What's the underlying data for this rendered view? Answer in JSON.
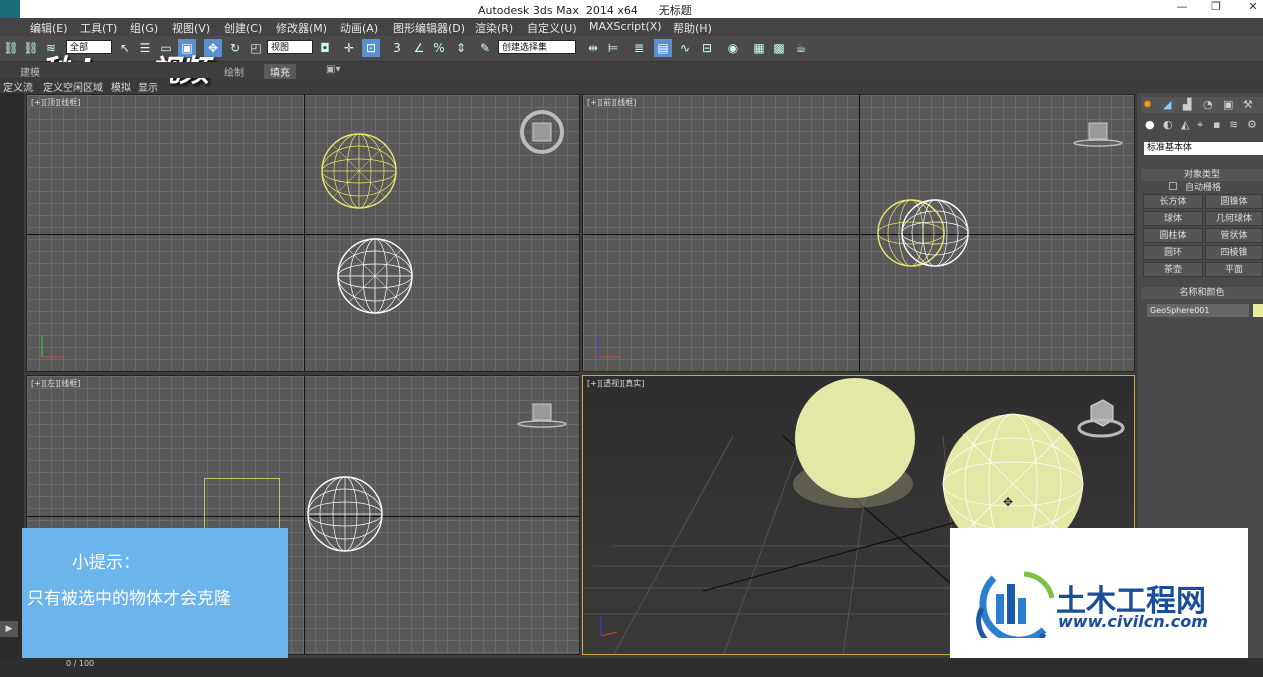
{
  "window": {
    "title": "Autodesk 3ds Max  2014 x64      无标题"
  },
  "menu": [
    "编辑(E)",
    "工具(T)",
    "组(G)",
    "视图(V)",
    "创建(C)",
    "修改器(M)",
    "动画(A)",
    "图形编辑器(D)",
    "渲染(R)",
    "自定义(U)",
    "MAXScript(X)",
    "帮助(H)"
  ],
  "toolbar": {
    "filter_value": "全部",
    "ref_coord": "视图",
    "selection_set": "创建选择集"
  },
  "ribbon": {
    "tabs": [
      "建模",
      "绘制",
      "填充"
    ]
  },
  "subtabs": [
    "定义流",
    "定义空闲区域",
    "模拟",
    "显示"
  ],
  "viewports": {
    "top": {
      "label": "[+][顶][线框]"
    },
    "front": {
      "label": "[+][前][线框]"
    },
    "left": {
      "label": "[+][左][线框]"
    },
    "perspective": {
      "label": "[+][透视][真实]"
    }
  },
  "command_panel": {
    "category": "标准基本体",
    "rollout_object_type": "对象类型",
    "autogrid": "自动栅格",
    "buttons": [
      "长方体",
      "圆锥体",
      "球体",
      "几何球体",
      "圆柱体",
      "管状体",
      "圆环",
      "四棱锥",
      "茶壶",
      "平面"
    ],
    "rollout_name_color": "名称和颜色",
    "object_name": "GeoSphere001",
    "object_color": "#e8eca0"
  },
  "tip": {
    "title": "小提示：",
    "text": "只有被选中的物体才会克隆"
  },
  "watermark": {
    "text": "秒dong视频"
  },
  "logo": {
    "brand": "土木工程网",
    "url": "www.civilcn.com"
  },
  "timeline": {
    "frame": "0 / 100"
  },
  "colors": {
    "selected_wire": "#e6ea6a",
    "sphere": "#e4e8a6",
    "persp_border": "#c9a640",
    "tip_bg": "#6cb4ec"
  }
}
